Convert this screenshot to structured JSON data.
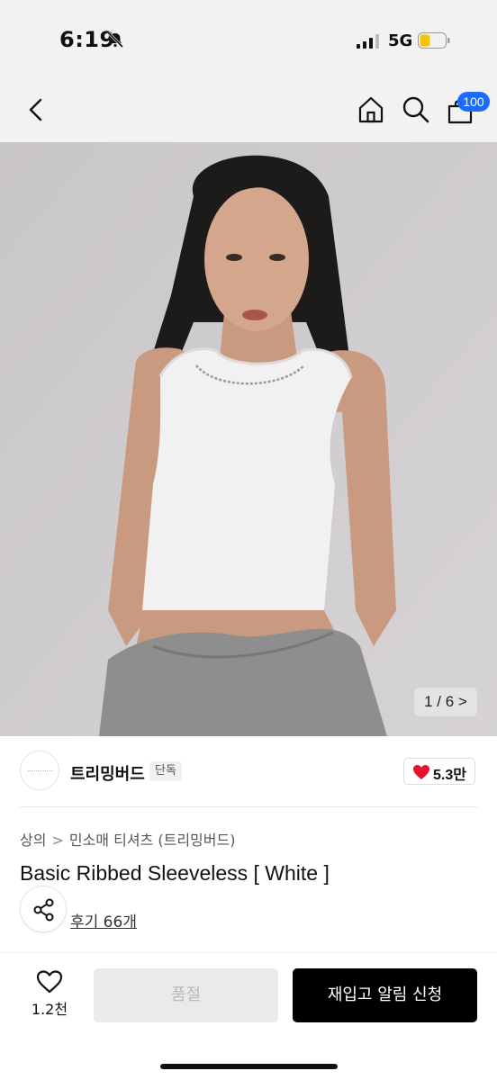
{
  "status": {
    "time": "6:19",
    "network": "5G"
  },
  "nav": {
    "cart_count": "100"
  },
  "gallery": {
    "counter": "1 / 6 >"
  },
  "brand": {
    "name": "트리밍버드",
    "exclusive_badge": "단독",
    "like_count": "5.3만"
  },
  "breadcrumb": {
    "category": "상의",
    "separator": ">",
    "subcategory": "민소매 티셔츠 (트리밍버드)"
  },
  "product": {
    "title": "Basic Ribbed Sleeveless [ White ]",
    "reviews": "후기 66개"
  },
  "actions": {
    "wishlist_count": "1.2천",
    "soldout_label": "품절",
    "restock_label": "재입고 알림 신청"
  },
  "colors": {
    "accent_badge": "#1a6bff",
    "heart": "#e8122d",
    "primary_button": "#000000"
  }
}
